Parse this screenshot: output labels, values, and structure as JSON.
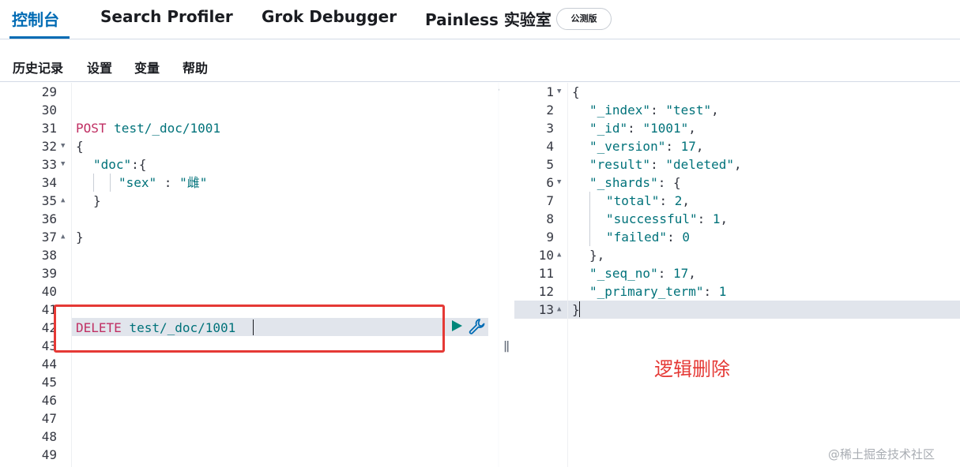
{
  "tabs": [
    {
      "label": "控制台",
      "active": true
    },
    {
      "label": "Search Profiler"
    },
    {
      "label": "Grok Debugger"
    },
    {
      "label": "Painless 实验室"
    }
  ],
  "beta_badge": "公测版",
  "menu": [
    "历史记录",
    "设置",
    "变量",
    "帮助"
  ],
  "request_editor": {
    "line_numbers": [
      "29",
      "30",
      "31",
      "32",
      "33",
      "34",
      "35",
      "36",
      "37",
      "38",
      "39",
      "40",
      "41",
      "42",
      "43",
      "44",
      "45",
      "46",
      "47",
      "48",
      "49"
    ],
    "lines": {
      "l31_method": "POST",
      "l31_url": "test/_doc/1001",
      "l32": "{",
      "l33_key": "\"doc\"",
      "l33_punc": ":{",
      "l34_key": "\"sex\"",
      "l34_punc": " : ",
      "l34_val": "\"雌\"",
      "l35": "}",
      "l37": "}",
      "l42_method": "DELETE",
      "l42_url": "test/_doc/1001"
    }
  },
  "response_editor": {
    "line_numbers": [
      "1",
      "2",
      "3",
      "4",
      "5",
      "6",
      "7",
      "8",
      "9",
      "10",
      "11",
      "12",
      "13"
    ],
    "lines": {
      "r1": "{",
      "r2_key": "\"_index\"",
      "r2_val": "\"test\"",
      "r3_key": "\"_id\"",
      "r3_val": "\"1001\"",
      "r4_key": "\"_version\"",
      "r4_val": "17",
      "r5_key": "\"result\"",
      "r5_val": "\"deleted\"",
      "r6_key": "\"_shards\"",
      "r6_punc": ": {",
      "r7_key": "\"total\"",
      "r7_val": "2",
      "r8_key": "\"successful\"",
      "r8_val": "1",
      "r9_key": "\"failed\"",
      "r9_val": "0",
      "r10": "},",
      "r11_key": "\"_seq_no\"",
      "r11_val": "17",
      "r12_key": "\"_primary_term\"",
      "r12_val": "1",
      "r13": "}"
    }
  },
  "annotation": "逻辑删除",
  "watermark": "@稀土掘金技术社区",
  "colors": {
    "accent": "#006bb4",
    "method": "#c02f63",
    "value": "#00727a",
    "annotation": "#e53935"
  }
}
